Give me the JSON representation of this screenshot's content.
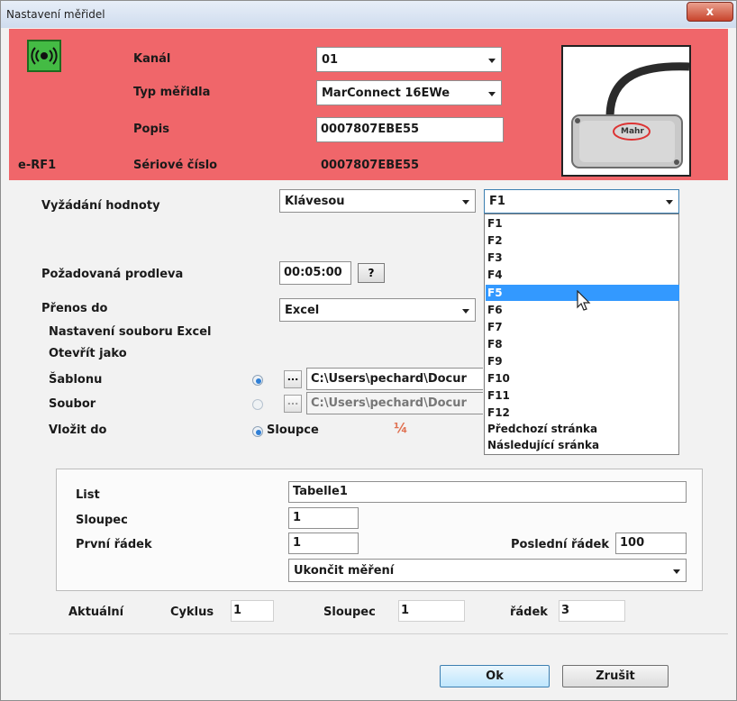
{
  "window": {
    "title": "Nastavení měřidel",
    "close_glyph": "x"
  },
  "header": {
    "device_code": "e-RF1",
    "channel": {
      "label": "Kanál",
      "value": "01"
    },
    "gauge_type": {
      "label": "Typ měřidla",
      "value": "MarConnect 16EWe"
    },
    "description": {
      "label": "Popis",
      "value": "0007807EBE55"
    },
    "serial": {
      "label": "Sériové číslo",
      "value": "0007807EBE55"
    },
    "image_brand": "Mahr"
  },
  "request": {
    "label": "Vyžádání hodnoty",
    "mode_value": "Klávesou",
    "key_value": "F1",
    "key_options": [
      "F1",
      "F2",
      "F3",
      "F4",
      "F5",
      "F6",
      "F7",
      "F8",
      "F9",
      "F10",
      "F11",
      "F12",
      "Předchozí stránka",
      "Následující sránka"
    ],
    "selected_option": "F5"
  },
  "delay": {
    "label": "Požadovaná prodleva",
    "value": "00:05:00",
    "help_label": "?"
  },
  "transfer": {
    "label": "Přenos do",
    "value": "Excel"
  },
  "excel": {
    "section_title": "Nastavení souboru Excel",
    "open_as_label": "Otevřít jako",
    "template_label": "Šablonu",
    "template_path": "C:\\Users\\pechard\\Docur",
    "file_label": "Soubor",
    "file_path": "C:\\Users\\pechard\\Docur",
    "browse_label": "...",
    "insert_label": "Vložit do",
    "insert_value": "Sloupce",
    "excel_icon_text": "¼"
  },
  "sheet": {
    "list_label": "List",
    "list_value": "Tabelle1",
    "column_label": "Sloupec",
    "column_value": "1",
    "first_row_label": "První řádek",
    "first_row_value": "1",
    "last_row_label": "Poslední řádek",
    "last_row_value": "100",
    "end_action_value": "Ukončit měření"
  },
  "current": {
    "label": "Aktuální",
    "cycle_label": "Cyklus",
    "cycle_value": "1",
    "column_label": "Sloupec",
    "column_value": "1",
    "row_label": "řádek",
    "row_value": "3"
  },
  "buttons": {
    "ok": "Ok",
    "cancel": "Zrušit"
  }
}
